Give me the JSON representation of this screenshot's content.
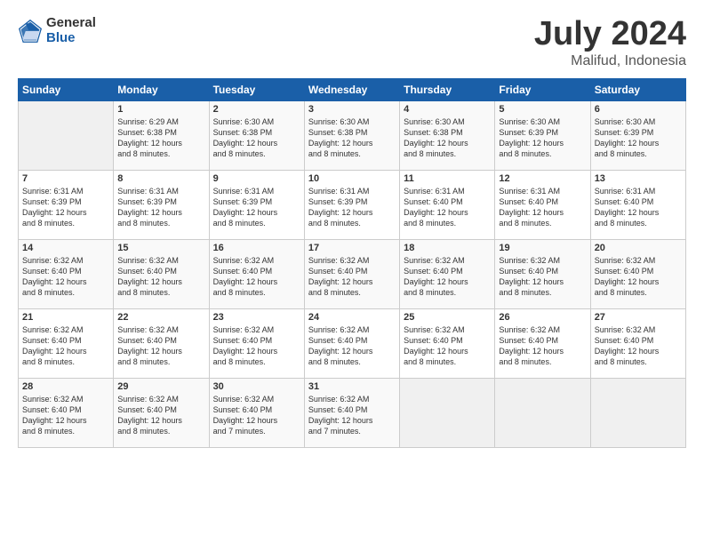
{
  "logo": {
    "general": "General",
    "blue": "Blue"
  },
  "title": {
    "month_year": "July 2024",
    "location": "Malifud, Indonesia"
  },
  "weekdays": [
    "Sunday",
    "Monday",
    "Tuesday",
    "Wednesday",
    "Thursday",
    "Friday",
    "Saturday"
  ],
  "weeks": [
    [
      {
        "day": "",
        "info": ""
      },
      {
        "day": "1",
        "info": "Sunrise: 6:29 AM\nSunset: 6:38 PM\nDaylight: 12 hours\nand 8 minutes."
      },
      {
        "day": "2",
        "info": "Sunrise: 6:30 AM\nSunset: 6:38 PM\nDaylight: 12 hours\nand 8 minutes."
      },
      {
        "day": "3",
        "info": "Sunrise: 6:30 AM\nSunset: 6:38 PM\nDaylight: 12 hours\nand 8 minutes."
      },
      {
        "day": "4",
        "info": "Sunrise: 6:30 AM\nSunset: 6:38 PM\nDaylight: 12 hours\nand 8 minutes."
      },
      {
        "day": "5",
        "info": "Sunrise: 6:30 AM\nSunset: 6:39 PM\nDaylight: 12 hours\nand 8 minutes."
      },
      {
        "day": "6",
        "info": "Sunrise: 6:30 AM\nSunset: 6:39 PM\nDaylight: 12 hours\nand 8 minutes."
      }
    ],
    [
      {
        "day": "7",
        "info": "Sunrise: 6:31 AM\nSunset: 6:39 PM\nDaylight: 12 hours\nand 8 minutes."
      },
      {
        "day": "8",
        "info": "Sunrise: 6:31 AM\nSunset: 6:39 PM\nDaylight: 12 hours\nand 8 minutes."
      },
      {
        "day": "9",
        "info": "Sunrise: 6:31 AM\nSunset: 6:39 PM\nDaylight: 12 hours\nand 8 minutes."
      },
      {
        "day": "10",
        "info": "Sunrise: 6:31 AM\nSunset: 6:39 PM\nDaylight: 12 hours\nand 8 minutes."
      },
      {
        "day": "11",
        "info": "Sunrise: 6:31 AM\nSunset: 6:40 PM\nDaylight: 12 hours\nand 8 minutes."
      },
      {
        "day": "12",
        "info": "Sunrise: 6:31 AM\nSunset: 6:40 PM\nDaylight: 12 hours\nand 8 minutes."
      },
      {
        "day": "13",
        "info": "Sunrise: 6:31 AM\nSunset: 6:40 PM\nDaylight: 12 hours\nand 8 minutes."
      }
    ],
    [
      {
        "day": "14",
        "info": "Sunrise: 6:32 AM\nSunset: 6:40 PM\nDaylight: 12 hours\nand 8 minutes."
      },
      {
        "day": "15",
        "info": "Sunrise: 6:32 AM\nSunset: 6:40 PM\nDaylight: 12 hours\nand 8 minutes."
      },
      {
        "day": "16",
        "info": "Sunrise: 6:32 AM\nSunset: 6:40 PM\nDaylight: 12 hours\nand 8 minutes."
      },
      {
        "day": "17",
        "info": "Sunrise: 6:32 AM\nSunset: 6:40 PM\nDaylight: 12 hours\nand 8 minutes."
      },
      {
        "day": "18",
        "info": "Sunrise: 6:32 AM\nSunset: 6:40 PM\nDaylight: 12 hours\nand 8 minutes."
      },
      {
        "day": "19",
        "info": "Sunrise: 6:32 AM\nSunset: 6:40 PM\nDaylight: 12 hours\nand 8 minutes."
      },
      {
        "day": "20",
        "info": "Sunrise: 6:32 AM\nSunset: 6:40 PM\nDaylight: 12 hours\nand 8 minutes."
      }
    ],
    [
      {
        "day": "21",
        "info": "Sunrise: 6:32 AM\nSunset: 6:40 PM\nDaylight: 12 hours\nand 8 minutes."
      },
      {
        "day": "22",
        "info": "Sunrise: 6:32 AM\nSunset: 6:40 PM\nDaylight: 12 hours\nand 8 minutes."
      },
      {
        "day": "23",
        "info": "Sunrise: 6:32 AM\nSunset: 6:40 PM\nDaylight: 12 hours\nand 8 minutes."
      },
      {
        "day": "24",
        "info": "Sunrise: 6:32 AM\nSunset: 6:40 PM\nDaylight: 12 hours\nand 8 minutes."
      },
      {
        "day": "25",
        "info": "Sunrise: 6:32 AM\nSunset: 6:40 PM\nDaylight: 12 hours\nand 8 minutes."
      },
      {
        "day": "26",
        "info": "Sunrise: 6:32 AM\nSunset: 6:40 PM\nDaylight: 12 hours\nand 8 minutes."
      },
      {
        "day": "27",
        "info": "Sunrise: 6:32 AM\nSunset: 6:40 PM\nDaylight: 12 hours\nand 8 minutes."
      }
    ],
    [
      {
        "day": "28",
        "info": "Sunrise: 6:32 AM\nSunset: 6:40 PM\nDaylight: 12 hours\nand 8 minutes."
      },
      {
        "day": "29",
        "info": "Sunrise: 6:32 AM\nSunset: 6:40 PM\nDaylight: 12 hours\nand 8 minutes."
      },
      {
        "day": "30",
        "info": "Sunrise: 6:32 AM\nSunset: 6:40 PM\nDaylight: 12 hours\nand 7 minutes."
      },
      {
        "day": "31",
        "info": "Sunrise: 6:32 AM\nSunset: 6:40 PM\nDaylight: 12 hours\nand 7 minutes."
      },
      {
        "day": "",
        "info": ""
      },
      {
        "day": "",
        "info": ""
      },
      {
        "day": "",
        "info": ""
      }
    ]
  ]
}
